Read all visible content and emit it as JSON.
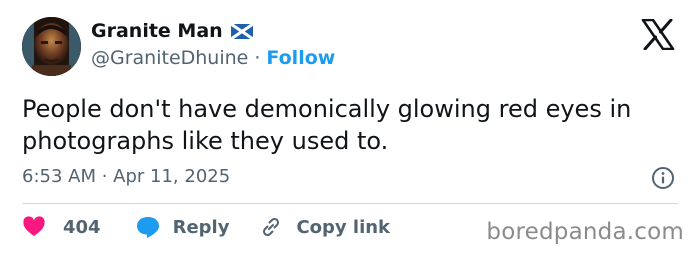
{
  "tweet": {
    "author_name": "Granite Man",
    "author_handle": "@GraniteDhuine",
    "separator": "·",
    "follow_label": "Follow",
    "text": "People don't have demonically glowing red eyes in photographs like they used to.",
    "timestamp": "6:53 AM · Apr 11, 2025",
    "likes_count": "404",
    "reply_label": "Reply",
    "copy_link_label": "Copy link"
  },
  "icons": {
    "flag": "scotland-flag-icon",
    "platform": "x-logo-icon",
    "info": "info-icon",
    "like": "heart-icon",
    "reply": "speech-bubble-icon",
    "link": "link-icon"
  },
  "colors": {
    "text": "#0f1419",
    "secondary": "#536471",
    "accent": "#1d9bf0",
    "like": "#f91880",
    "flag_blue": "#1f5fae",
    "divider": "#cfd9de"
  },
  "watermark": "boredpanda.com"
}
